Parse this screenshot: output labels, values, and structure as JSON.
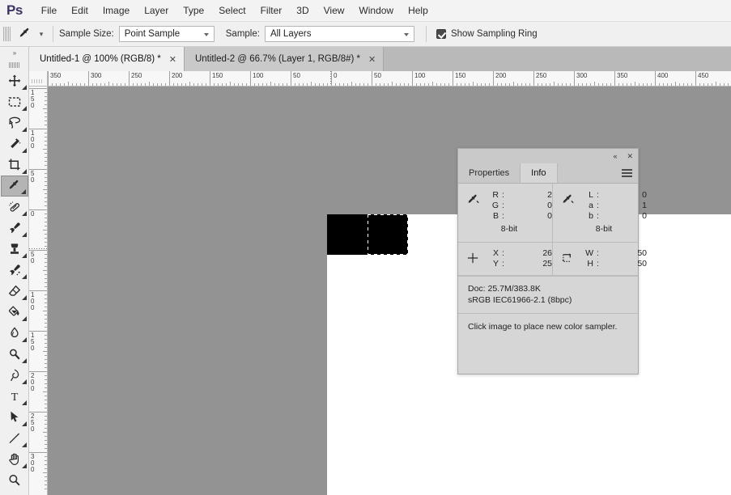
{
  "app": {
    "logo": "Ps",
    "menus": [
      "File",
      "Edit",
      "Image",
      "Layer",
      "Type",
      "Select",
      "Filter",
      "3D",
      "View",
      "Window",
      "Help"
    ]
  },
  "options_bar": {
    "tool_icon": "eyedropper-icon",
    "sample_size_label": "Sample Size:",
    "sample_size_value": "Point Sample",
    "sample_label": "Sample:",
    "sample_value": "All Layers",
    "show_sampling_ring_label": "Show Sampling Ring",
    "show_sampling_ring_checked": true
  },
  "toolbar": {
    "collapse_glyph": "»",
    "tools": [
      {
        "name": "move-tool",
        "icon": "move-icon",
        "has_flyout": true,
        "active": false
      },
      {
        "name": "rectangular-marquee-tool",
        "icon": "marquee-rect-icon",
        "has_flyout": true,
        "active": false
      },
      {
        "name": "lasso-tool",
        "icon": "lasso-icon",
        "has_flyout": true,
        "active": false
      },
      {
        "name": "quick-selection-tool",
        "icon": "magic-wand-icon",
        "has_flyout": true,
        "active": false
      },
      {
        "name": "crop-tool",
        "icon": "crop-icon",
        "has_flyout": true,
        "active": false
      },
      {
        "name": "eyedropper-tool",
        "icon": "eyedropper-icon",
        "has_flyout": true,
        "active": true
      },
      {
        "name": "spot-healing-brush-tool",
        "icon": "healing-brush-icon",
        "has_flyout": true,
        "active": false
      },
      {
        "name": "brush-tool",
        "icon": "brush-icon",
        "has_flyout": true,
        "active": false
      },
      {
        "name": "clone-stamp-tool",
        "icon": "clone-stamp-icon",
        "has_flyout": true,
        "active": false
      },
      {
        "name": "history-brush-tool",
        "icon": "history-brush-icon",
        "has_flyout": true,
        "active": false
      },
      {
        "name": "eraser-tool",
        "icon": "eraser-icon",
        "has_flyout": true,
        "active": false
      },
      {
        "name": "gradient-tool",
        "icon": "paint-bucket-icon",
        "has_flyout": true,
        "active": false
      },
      {
        "name": "blur-tool",
        "icon": "blur-drop-icon",
        "has_flyout": true,
        "active": false
      },
      {
        "name": "dodge-tool",
        "icon": "dodge-icon",
        "has_flyout": true,
        "active": false
      },
      {
        "name": "pen-tool",
        "icon": "pen-icon",
        "has_flyout": true,
        "active": false
      },
      {
        "name": "type-tool",
        "icon": "type-t-icon",
        "has_flyout": true,
        "active": false
      },
      {
        "name": "path-selection-tool",
        "icon": "arrow-pointer-icon",
        "has_flyout": true,
        "active": false
      },
      {
        "name": "line-tool",
        "icon": "line-shape-icon",
        "has_flyout": true,
        "active": false
      },
      {
        "name": "hand-tool",
        "icon": "hand-icon",
        "has_flyout": true,
        "active": false
      },
      {
        "name": "zoom-tool",
        "icon": "magnifier-icon",
        "has_flyout": false,
        "active": false
      }
    ]
  },
  "tabs": [
    {
      "title": "Untitled-1 @ 100% (RGB/8) *",
      "close": "✕",
      "active": true
    },
    {
      "title": "Untitled-2 @ 66.7% (Layer 1, RGB/8#) *",
      "close": "✕",
      "active": false
    }
  ],
  "rulers": {
    "horizontal_labels": [
      "350",
      "300",
      "250",
      "200",
      "150",
      "100",
      "50",
      "0",
      "50",
      "100",
      "150",
      "200",
      "250",
      "300",
      "350",
      "400",
      "450"
    ],
    "vertical_labels": [
      "150",
      "100",
      "50",
      "0",
      "50",
      "100",
      "150",
      "200",
      "250",
      "300"
    ],
    "unit": "pixels"
  },
  "canvas": {
    "background_color": "#939393",
    "document_color": "#ffffff",
    "shape_color": "#000000",
    "selection": "marching-ants"
  },
  "info_panel": {
    "collapse_glyph": "«",
    "close_glyph": "✕",
    "tabs": [
      {
        "label": "Properties",
        "active": false
      },
      {
        "label": "Info",
        "active": true
      }
    ],
    "readout_primary": {
      "icon": "eyedropper-icon",
      "keys": [
        "R",
        "G",
        "B"
      ],
      "separator": ":",
      "values": [
        "2",
        "0",
        "0"
      ],
      "depth": "8-bit"
    },
    "readout_secondary": {
      "icon": "eyedropper-icon",
      "keys": [
        "L",
        "a",
        "b"
      ],
      "separator": ":",
      "values": [
        "0",
        "1",
        "0"
      ],
      "depth": "8-bit"
    },
    "coords": {
      "icon": "crosshair-icon",
      "keys": [
        "X",
        "Y"
      ],
      "separator": ":",
      "values": [
        "26",
        "25"
      ]
    },
    "dimensions": {
      "icon": "selection-bounds-icon",
      "keys": [
        "W",
        "H"
      ],
      "separator": ":",
      "values": [
        "50",
        "50"
      ]
    },
    "doc_line1": "Doc: 25.7M/383.8K",
    "doc_line2": "sRGB IEC61966-2.1 (8bpc)",
    "hint": "Click image to place new color sampler."
  }
}
